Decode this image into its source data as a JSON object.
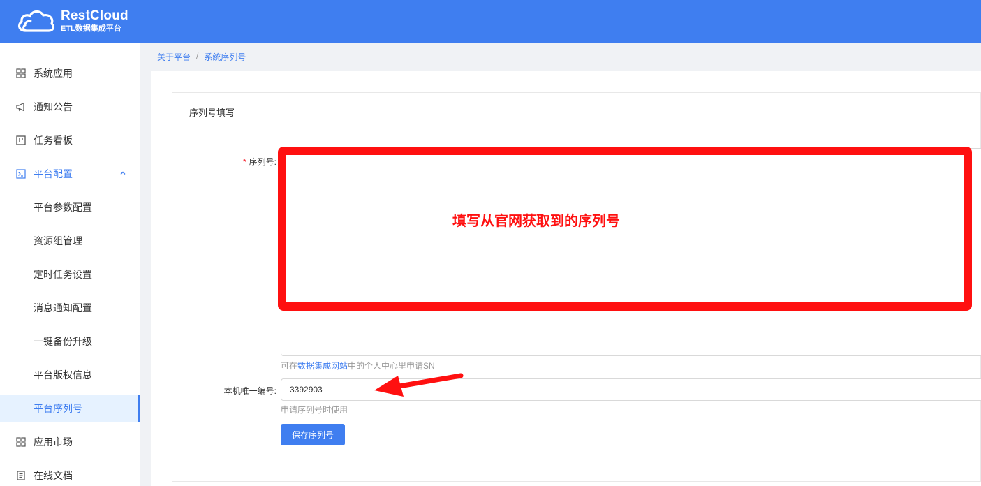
{
  "brand": {
    "title": "RestCloud",
    "subtitle": "ETL数据集成平台"
  },
  "sidebar": {
    "items": [
      {
        "label": "系统应用",
        "icon": "grid-icon"
      },
      {
        "label": "通知公告",
        "icon": "megaphone-icon"
      },
      {
        "label": "任务看板",
        "icon": "kanban-icon"
      },
      {
        "label": "平台配置",
        "icon": "terminal-icon",
        "expanded": true
      },
      {
        "label": "平台参数配置"
      },
      {
        "label": "资源组管理"
      },
      {
        "label": "定时任务设置"
      },
      {
        "label": "消息通知配置"
      },
      {
        "label": "一键备份升级"
      },
      {
        "label": "平台版权信息"
      },
      {
        "label": "平台序列号",
        "active": true
      },
      {
        "label": "应用市场",
        "icon": "grid-icon"
      },
      {
        "label": "在线文档",
        "icon": "document-icon"
      }
    ]
  },
  "breadcrumb": {
    "parent": "关于平台",
    "separator": "/",
    "current": "系统序列号"
  },
  "card": {
    "title": "序列号填写"
  },
  "form": {
    "serial_label": "序列号:",
    "serial_hint_prefix": "可在",
    "serial_hint_link": "数据集成网站",
    "serial_hint_suffix": "中的个人中心里申请SN",
    "machine_label": "本机唯一编号:",
    "machine_value": "3392903",
    "machine_hint": "申请序列号时使用",
    "save_label": "保存序列号"
  },
  "annotation": {
    "text": "填写从官网获取到的序列号",
    "color": "#ff1010"
  },
  "colors": {
    "primary": "#3f7ef0",
    "required": "#f5222d"
  }
}
